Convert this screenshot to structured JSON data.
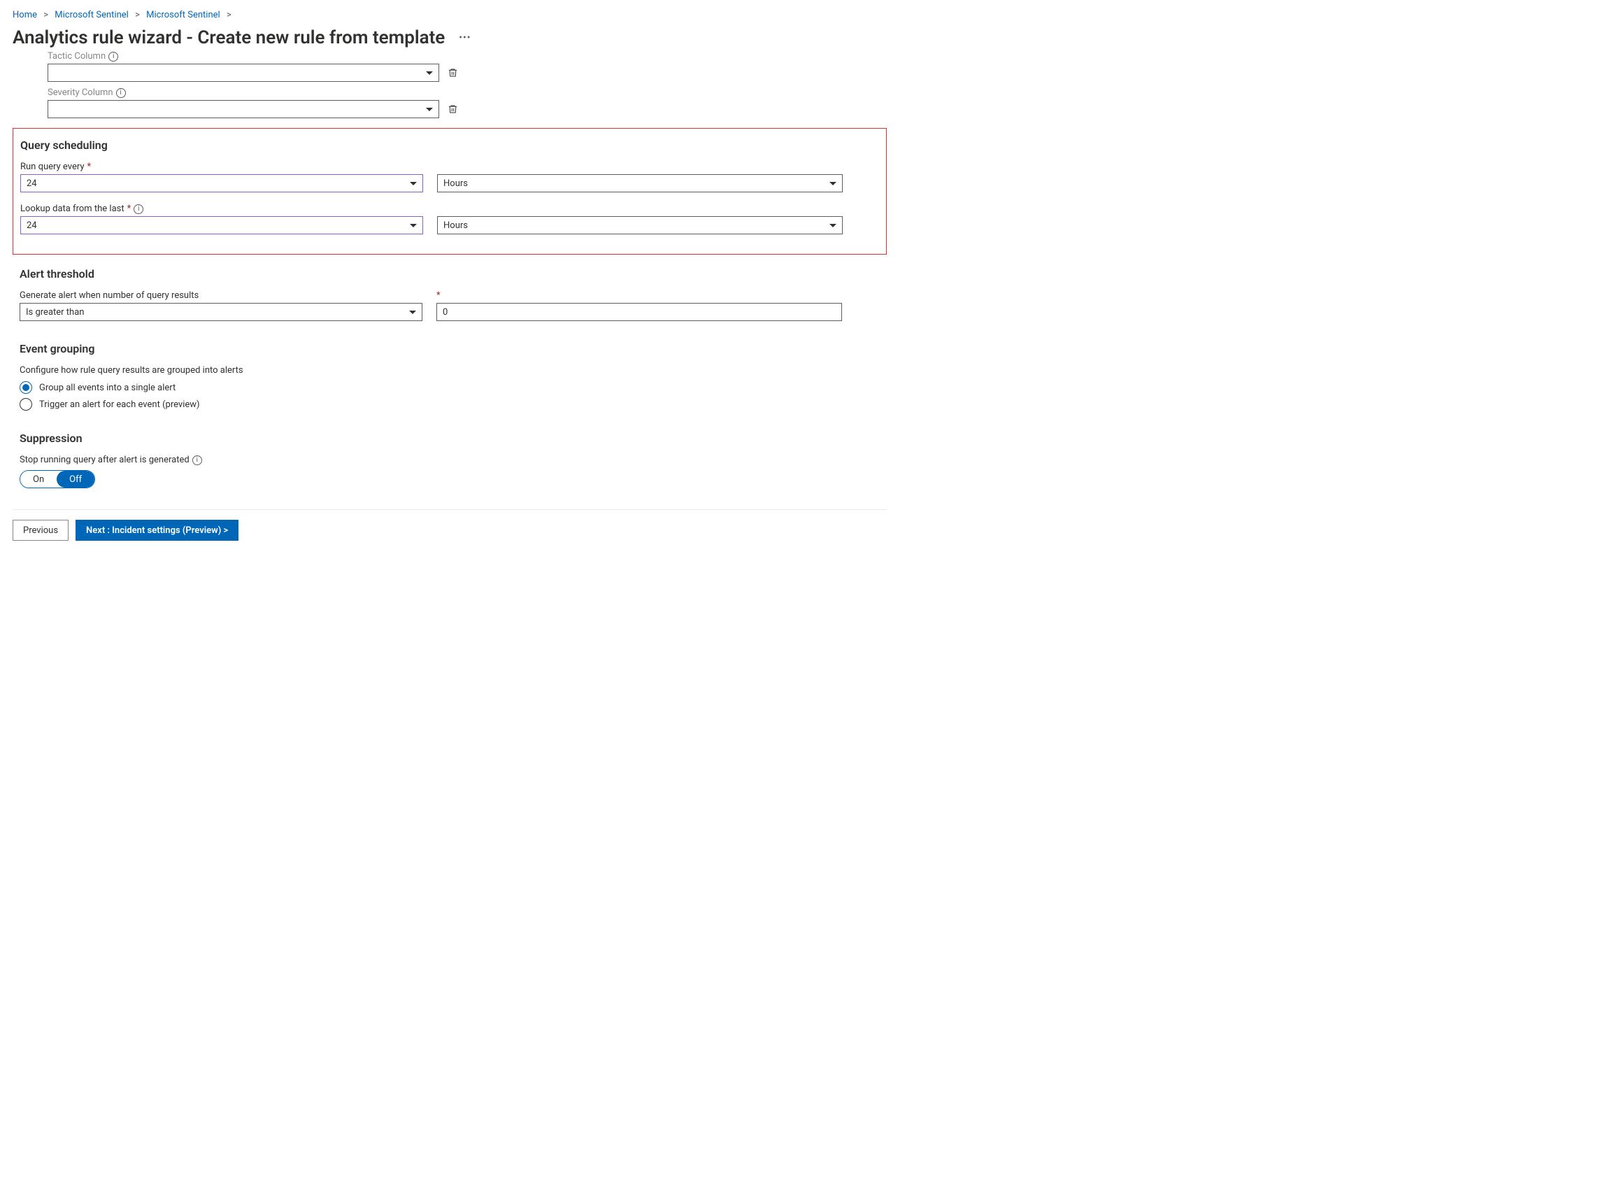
{
  "breadcrumb": {
    "home": "Home",
    "s1": "Microsoft Sentinel",
    "s2": "Microsoft Sentinel"
  },
  "page_title": "Analytics rule wizard - Create new rule from template",
  "columns": {
    "tactic_label": "Tactic Column",
    "severity_label": "Severity Column"
  },
  "scheduling": {
    "heading": "Query scheduling",
    "run_label": "Run query every",
    "run_value": "24",
    "run_unit": "Hours",
    "lookup_label": "Lookup data from the last",
    "lookup_value": "24",
    "lookup_unit": "Hours"
  },
  "threshold": {
    "heading": "Alert threshold",
    "label": "Generate alert when number of query results",
    "operator": "Is greater than",
    "value": "0"
  },
  "grouping": {
    "heading": "Event grouping",
    "desc": "Configure how rule query results are grouped into alerts",
    "opt1": "Group all events into a single alert",
    "opt2": "Trigger an alert for each event (preview)"
  },
  "suppression": {
    "heading": "Suppression",
    "label": "Stop running query after alert is generated",
    "on": "On",
    "off": "Off"
  },
  "footer": {
    "prev": "Previous",
    "next": "Next : Incident settings (Preview) >"
  }
}
